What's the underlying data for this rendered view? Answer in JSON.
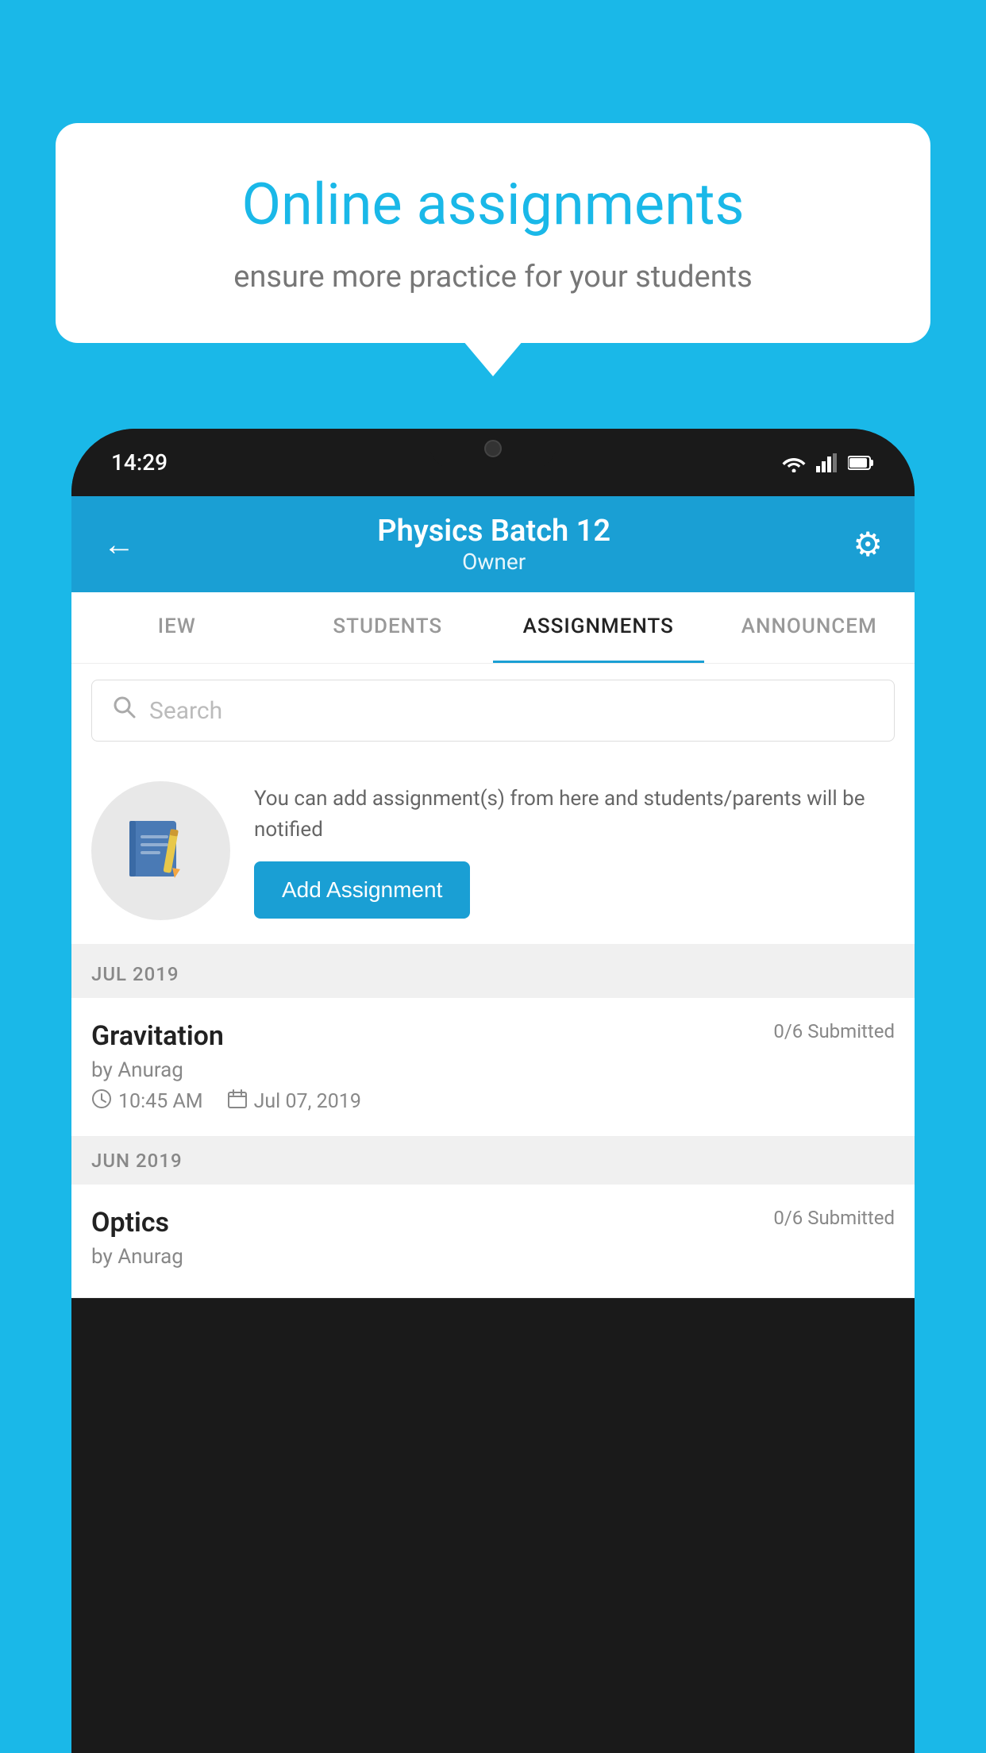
{
  "background_color": "#1ab8e8",
  "speech_bubble": {
    "title": "Online assignments",
    "subtitle": "ensure more practice for your students"
  },
  "phone": {
    "status_bar": {
      "time": "14:29"
    },
    "header": {
      "title": "Physics Batch 12",
      "subtitle": "Owner",
      "back_label": "←",
      "settings_label": "⚙"
    },
    "tabs": [
      {
        "label": "IEW",
        "active": false
      },
      {
        "label": "STUDENTS",
        "active": false
      },
      {
        "label": "ASSIGNMENTS",
        "active": true
      },
      {
        "label": "ANNOUNCEM",
        "active": false
      }
    ],
    "search": {
      "placeholder": "Search"
    },
    "promo": {
      "text": "You can add assignment(s) from here and students/parents will be notified",
      "button_label": "Add Assignment"
    },
    "sections": [
      {
        "month_label": "JUL 2019",
        "assignments": [
          {
            "name": "Gravitation",
            "submitted": "0/6 Submitted",
            "author": "by Anurag",
            "time": "10:45 AM",
            "date": "Jul 07, 2019"
          }
        ]
      },
      {
        "month_label": "JUN 2019",
        "assignments": [
          {
            "name": "Optics",
            "submitted": "0/6 Submitted",
            "author": "by Anurag",
            "time": "",
            "date": ""
          }
        ]
      }
    ]
  }
}
